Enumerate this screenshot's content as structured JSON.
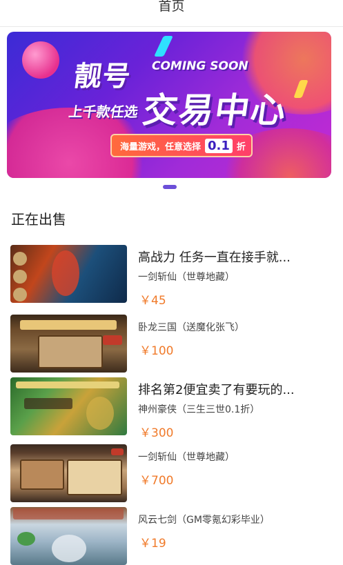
{
  "header": {
    "title": "首页"
  },
  "banner": {
    "headline": "靓号",
    "coming_soon": "COMING SOON",
    "subline": "上千款任选",
    "main_title": "交易中心",
    "pill_text": "海量游戏，任意选择",
    "pill_number": "0.1",
    "pill_suffix": "折",
    "colors": {
      "from": "#3b2bd6",
      "to": "#c52ad2",
      "accent": "#ff6a3c"
    }
  },
  "carousel": {
    "indicator_color": "#6c4fd8"
  },
  "section": {
    "title": "正在出售"
  },
  "listings": [
    {
      "title": "高战力 任务一直在接手就...",
      "subtitle": "一剑斩仙（世尊地藏）",
      "price": "￥45",
      "thumb": "game-thumbnail"
    },
    {
      "title": "",
      "subtitle": "卧龙三国（送魔化张飞）",
      "price": "￥100",
      "thumb": "game-thumbnail"
    },
    {
      "title": "排名第2便宜卖了有要玩的...",
      "subtitle": "神州豪侠（三生三世0.1折）",
      "price": "￥300",
      "thumb": "game-thumbnail"
    },
    {
      "title": "",
      "subtitle": "一剑斩仙（世尊地藏）",
      "price": "￥700",
      "thumb": "game-thumbnail"
    },
    {
      "title": "",
      "subtitle": "风云七剑（GM零氪幻彩毕业）",
      "price": "￥19",
      "thumb": "game-thumbnail"
    }
  ],
  "theme": {
    "price_color": "#f07a2a"
  }
}
